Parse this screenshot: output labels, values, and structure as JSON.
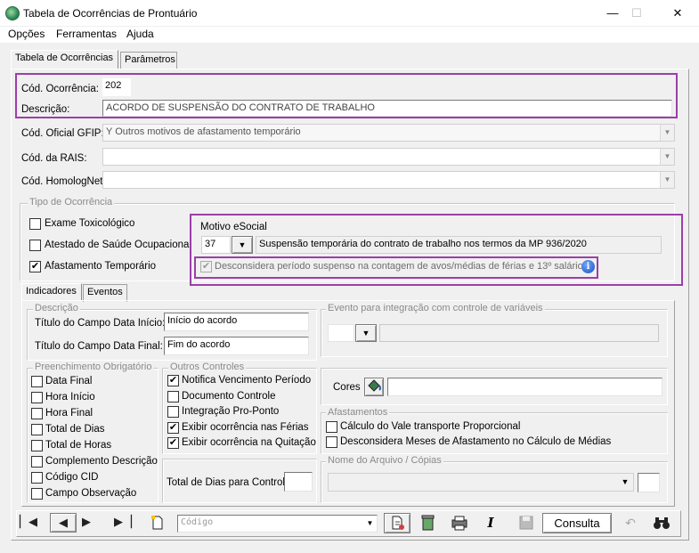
{
  "window": {
    "title": "Tabela de Ocorrências de Prontuário",
    "minimize": "—",
    "maximize": "☐",
    "close": "✕"
  },
  "menu": [
    "Opções",
    "Ferramentas",
    "Ajuda"
  ],
  "tabs": [
    "Tabela de Ocorrências",
    "Parâmetros"
  ],
  "form": {
    "cod_ocorrencia_label": "Cód. Ocorrência:",
    "cod_ocorrencia_value": "202",
    "descricao_label": "Descrição:",
    "descricao_value": "ACORDO DE SUSPENSÃO DO CONTRATO DE TRABALHO",
    "gfip_label": "Cód. Oficial GFIP:",
    "gfip_value": "Y  Outros motivos de afastamento temporário",
    "rais_label": "Cód. da RAIS:",
    "rais_value": "",
    "homolognet_label": "Cód. HomologNet:",
    "homolognet_value": ""
  },
  "tipo_ocorrencia": {
    "title": "Tipo de Ocorrência",
    "items": [
      {
        "label": "Exame Toxicológico",
        "checked": false
      },
      {
        "label": "Atestado de Saúde Ocupacional",
        "checked": false
      },
      {
        "label": "Afastamento Temporário",
        "checked": true
      }
    ]
  },
  "esocial": {
    "title": "Motivo eSocial",
    "code": "37",
    "description": "Suspensão temporária do contrato de trabalho nos termos da MP 936/2020",
    "desconsidera_label": "Desconsidera período suspenso na contagem de avos/médias de férias e 13º salário?"
  },
  "subtabs": [
    "Indicadores",
    "Eventos"
  ],
  "descricao_group": {
    "title": "Descrição",
    "inicio_label": "Título do Campo Data Início:",
    "inicio_value": "Início do acordo",
    "final_label": "Título do Campo Data Final:",
    "final_value": "Fim do acordo"
  },
  "evento_integracao": {
    "title": "Evento para integração com controle de variáveis"
  },
  "preenchimento": {
    "title": "Preenchimento Obrigatório",
    "items": [
      {
        "label": "Data Final",
        "checked": false
      },
      {
        "label": "Hora Início",
        "checked": false
      },
      {
        "label": "Hora Final",
        "checked": false
      },
      {
        "label": "Total de Dias",
        "checked": false
      },
      {
        "label": "Total de Horas",
        "checked": false
      },
      {
        "label": "Complemento Descrição",
        "checked": false
      },
      {
        "label": "Código CID",
        "checked": false
      },
      {
        "label": "Campo Observação",
        "checked": false
      }
    ]
  },
  "outros_controles": {
    "title": "Outros Controles",
    "items": [
      {
        "label": "Notifica Vencimento Período",
        "checked": true
      },
      {
        "label": "Documento Controle",
        "checked": false
      },
      {
        "label": "Integração Pro-Ponto",
        "checked": false
      },
      {
        "label": "Exibir ocorrência nas Férias",
        "checked": true
      },
      {
        "label": "Exibir ocorrência na Quitação",
        "checked": true
      }
    ]
  },
  "total_dias_label": "Total de Dias para Controle:",
  "cores_label": "Cores",
  "afastamentos": {
    "title": "Afastamentos",
    "items": [
      {
        "label": "Cálculo do Vale transporte Proporcional",
        "checked": false
      },
      {
        "label": "Desconsidera Meses de Afastamento no Cálculo de Médias",
        "checked": false
      }
    ]
  },
  "arquivo": {
    "title": "Nome do Arquivo / Cópias"
  },
  "toolbar": {
    "search_placeholder": "Código",
    "consulta_label": "Consulta"
  },
  "check_mark": "✔"
}
